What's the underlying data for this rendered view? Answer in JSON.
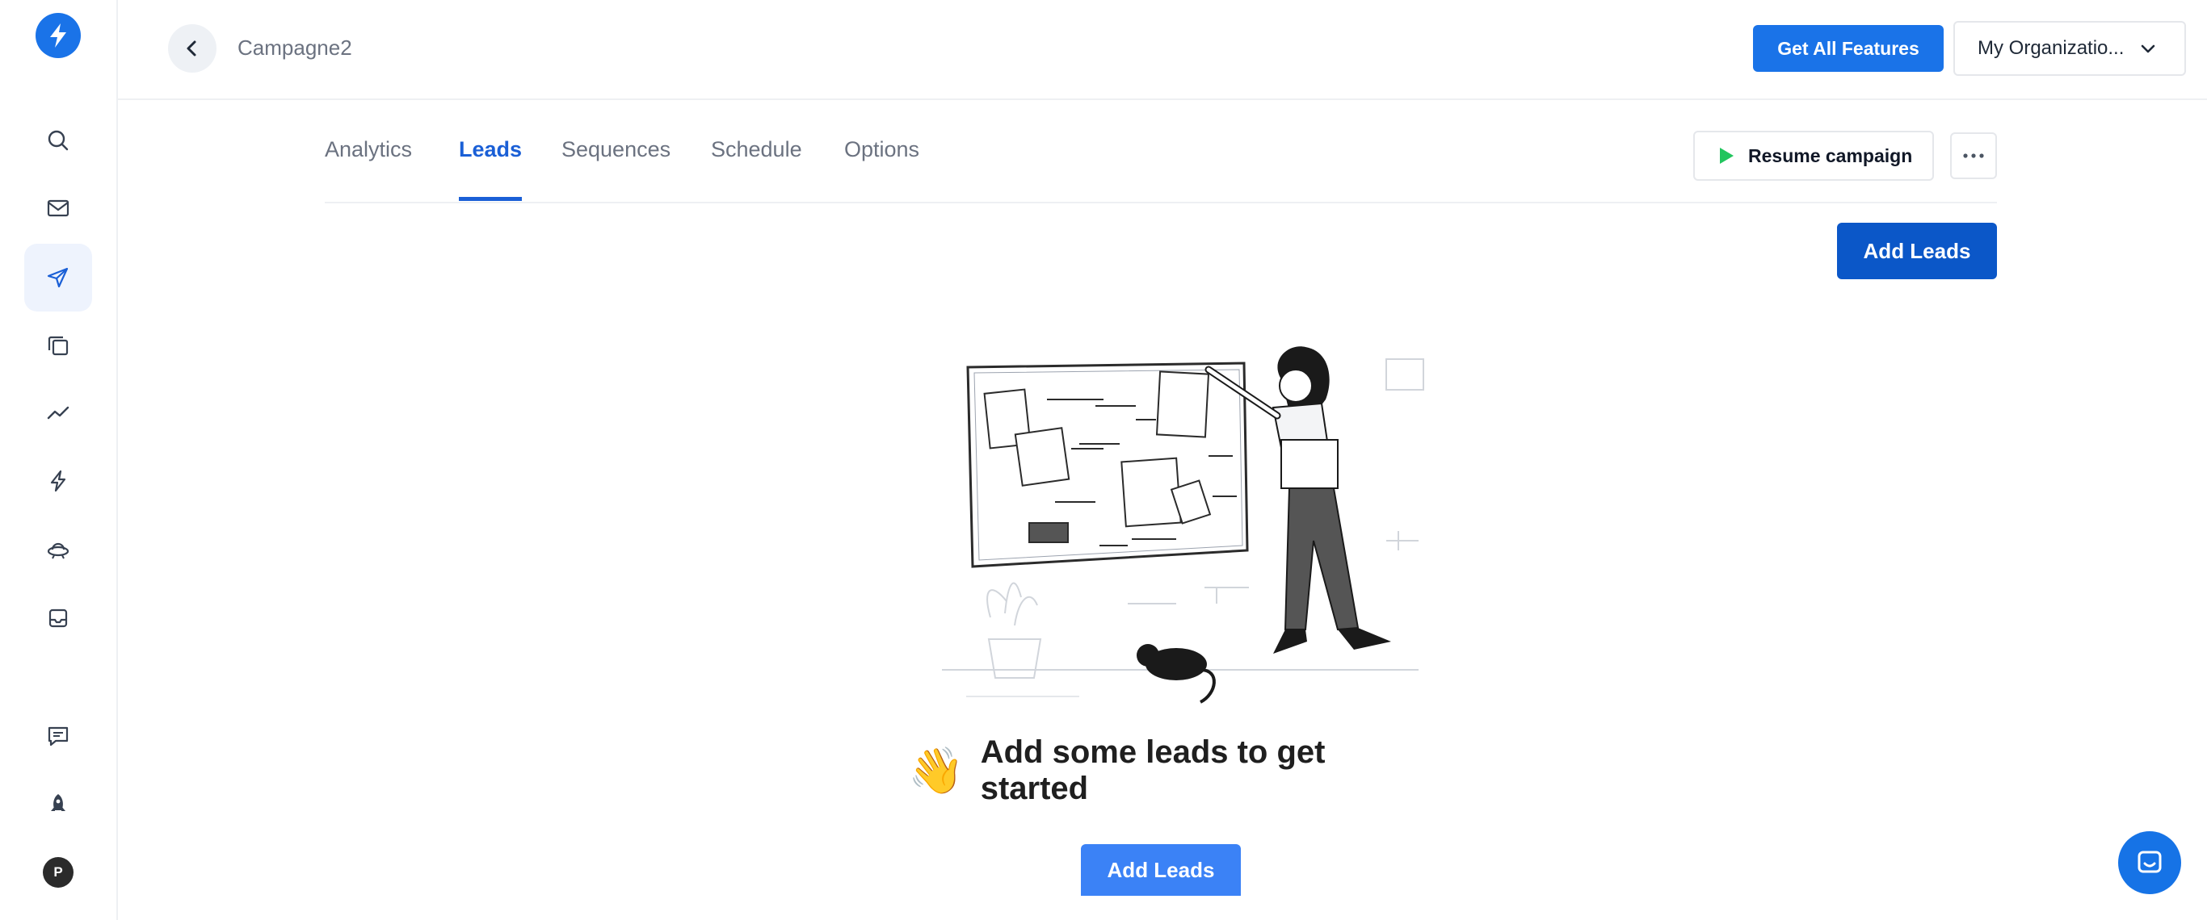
{
  "sidebar": {
    "logo_icon": "bolt-icon",
    "items": [
      {
        "icon": "search-icon",
        "active": false
      },
      {
        "icon": "mail-icon",
        "active": false
      },
      {
        "icon": "send-icon",
        "active": true
      },
      {
        "icon": "copy-icon",
        "active": false
      },
      {
        "icon": "trend-icon",
        "active": false
      },
      {
        "icon": "lightning-icon",
        "active": false
      },
      {
        "icon": "ufo-icon",
        "active": false
      },
      {
        "icon": "inbox-icon",
        "active": false
      },
      {
        "icon": "feedback-icon",
        "active": false
      },
      {
        "icon": "rocket-icon",
        "active": false
      }
    ],
    "avatar_initial": "P"
  },
  "header": {
    "breadcrumb": "Campagne2",
    "get_features_label": "Get All Features",
    "org_label": "My Organizatio..."
  },
  "tabs": [
    {
      "label": "Analytics",
      "active": false
    },
    {
      "label": "Leads",
      "active": true
    },
    {
      "label": "Sequences",
      "active": false
    },
    {
      "label": "Schedule",
      "active": false
    },
    {
      "label": "Options",
      "active": false
    }
  ],
  "actions": {
    "resume_label": "Resume campaign",
    "add_leads_label": "Add Leads"
  },
  "empty_state": {
    "emoji": "👋",
    "title": "Add some leads to get started",
    "button_label": "Add Leads"
  },
  "colors": {
    "primary": "#1a73e8",
    "primary_dark": "#0b57c8",
    "tab_active": "#1a5fd6",
    "resume_play": "#22c55e"
  }
}
